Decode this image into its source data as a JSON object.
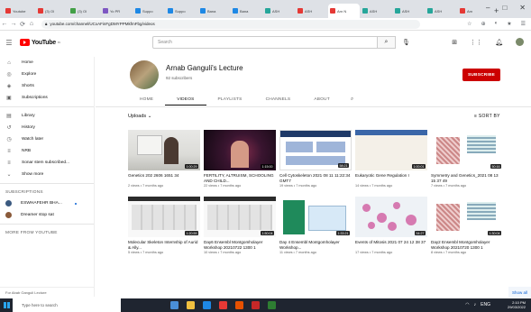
{
  "browser": {
    "tabs": [
      {
        "label": "Youtube",
        "color": "#e53935"
      },
      {
        "label": "(3) OI",
        "color": "#e53935"
      },
      {
        "label": "(3) OI",
        "color": "#43a047"
      },
      {
        "label": "Yo PR",
        "color": "#7e57c2"
      },
      {
        "label": "Suppo",
        "color": "#1e88e5"
      },
      {
        "label": "Suppo",
        "color": "#1e88e5"
      },
      {
        "label": "Bana",
        "color": "#1e88e5"
      },
      {
        "label": "Bana",
        "color": "#1e88e5"
      },
      {
        "label": "ASH",
        "color": "#26a69a"
      },
      {
        "label": "ASH",
        "color": "#e53935"
      },
      {
        "label": "Arn N",
        "color": "#e53935"
      },
      {
        "label": "ASH",
        "color": "#26a69a"
      },
      {
        "label": "ASH",
        "color": "#26a69a"
      },
      {
        "label": "ASH",
        "color": "#26a69a"
      },
      {
        "label": "Arn",
        "color": "#e53935"
      }
    ],
    "new_tab": "+",
    "url": "youtube.com/channel/UCxAFinFgDMYPPMkfmFbg/videos",
    "nav": [
      "←",
      "→",
      "⟳",
      "⌂"
    ],
    "addr_right": [
      "☆",
      "⊕",
      "◐",
      "★",
      "☰"
    ],
    "win_ctrls": [
      "–",
      "□",
      "✕"
    ]
  },
  "youtube": {
    "logo_text": "YouTube",
    "logo_sup": "IN",
    "search_placeholder": "Search",
    "header_icons": [
      "search-icon",
      "mic-icon",
      "create-icon",
      "apps-icon",
      "bell-icon"
    ]
  },
  "sidebar": {
    "items": [
      {
        "icon": "⌂",
        "label": "Home"
      },
      {
        "icon": "◎",
        "label": "Explore"
      },
      {
        "icon": "◈",
        "label": "Shorts"
      },
      {
        "icon": "▣",
        "label": "Subscriptions"
      }
    ],
    "library": [
      {
        "icon": "▤",
        "label": "Library"
      },
      {
        "icon": "↺",
        "label": "History"
      },
      {
        "icon": "◷",
        "label": "Watch later"
      },
      {
        "icon": "≡",
        "label": "NRB"
      },
      {
        "icon": "≡",
        "label": "Sonar stem subscribed..."
      },
      {
        "icon": "⌄",
        "label": "Show more"
      }
    ],
    "subscriptions_heading": "SUBSCRIPTIONS",
    "subscriptions": [
      {
        "label": "ESWHAFEHR BHA...",
        "color": "#3b5a80"
      },
      {
        "label": "Dreamer stop sat",
        "color": "#8a5a3a"
      }
    ],
    "more_heading": "MORE FROM YOUTUBE",
    "footer": "For Abab Ganguli Lecture"
  },
  "channel": {
    "name": "Arnab Ganguli's Lecture",
    "subs": "92 subscribers",
    "subscribe": "SUBSCRIBE",
    "tabs": [
      "HOME",
      "VIDEOS",
      "PLAYLISTS",
      "CHANNELS",
      "ABOUT"
    ],
    "active_tab": 1,
    "uploads_label": "Uploads ⌄",
    "sort_label": "SORT BY",
    "show_all": "Show all"
  },
  "videos": [
    {
      "title": "Genetics 202 2606 1651 34",
      "meta": "2 views • 7 months ago",
      "duration": "1:00:29",
      "style": "t-desk"
    },
    {
      "title": "FERTILITY, ALTRUISM, SCHOOLING AND CHILD...",
      "meta": "22 views • 7 months ago",
      "duration": "1:15:00",
      "style": "t-dark"
    },
    {
      "title": "Cell Cytoskeleton 2021 08 11 11:22:34 GMT7",
      "meta": "19 views • 7 months ago",
      "duration": "58:21",
      "style": "t-slide"
    },
    {
      "title": "Eukaryotic Gene Regulation I",
      "meta": "14 views • 7 months ago",
      "duration": "1:00:01",
      "style": "t-slide2"
    },
    {
      "title": "Symmetry and Genetics_2021 08 13 15 37 49",
      "meta": "7 views • 7 months ago",
      "duration": "50:16",
      "style": "t-fig"
    },
    {
      "title": "Molecular Skeleton Internship of Aurid & Ally...",
      "meta": "5 views • 7 months ago",
      "duration": "1:20:59",
      "style": "t-screen"
    },
    {
      "title": "Day6 Ensembl Montgomholayer Workshop 20210722 1300 1",
      "meta": "10 views • 7 months ago",
      "duration": "1:50:04",
      "style": "t-screen"
    },
    {
      "title": "Day 4 Ensembl Montgomholayer Workshop...",
      "meta": "11 views • 7 months ago",
      "duration": "1:33:21",
      "style": "t-green"
    },
    {
      "title": "Events of Mitosis 2021 07 24 12 38 37",
      "meta": "17 views • 7 months ago",
      "duration": "54:27",
      "style": "t-cells"
    },
    {
      "title": "Day2 Ensembl Montgomholayer Workshop 20210720 1300 1",
      "meta": "8 views • 7 months ago",
      "duration": "1:30:04",
      "style": "t-fig"
    }
  ],
  "taskbar": {
    "search": "Type here to search",
    "apps": [
      "#4a8fd8",
      "#f0c040",
      "#1e88e5",
      "#e53935",
      "#e65100",
      "#c62828",
      "#2e7d32"
    ],
    "time": "2:10 PM",
    "date": "29/03/2022",
    "lang": "ENG"
  }
}
